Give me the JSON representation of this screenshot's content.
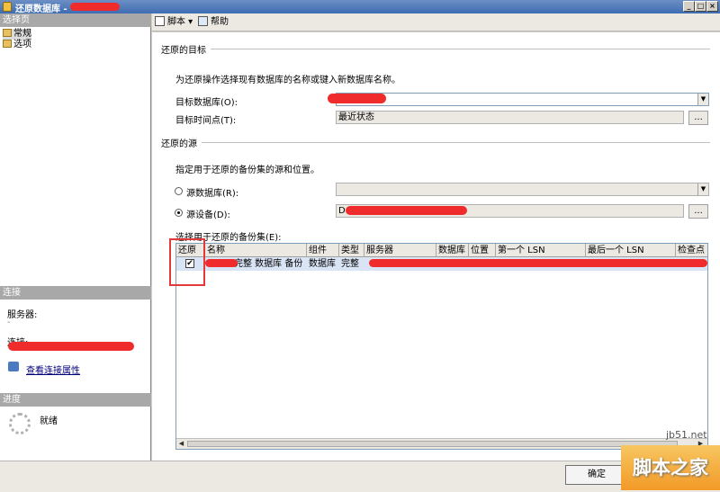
{
  "window": {
    "title": "还原数据库 -"
  },
  "left": {
    "select_page_header": "选择页",
    "pages": [
      {
        "label": "常规",
        "icon": "page-icon",
        "selected": true
      },
      {
        "label": "选项",
        "icon": "page-icon",
        "selected": false
      }
    ],
    "connection_header": "连接",
    "server_label": "服务器:",
    "server_value": "-",
    "connection_label": "连接:",
    "view_link": "查看连接属性",
    "progress_header": "进度",
    "status": "就绪"
  },
  "toolbar": {
    "script": "脚本 ▾",
    "help": "帮助"
  },
  "destination": {
    "heading": "还原的目标",
    "description": "为还原操作选择现有数据库的名称或键入新数据库名称。",
    "target_db_label": "目标数据库(O):",
    "target_time_label": "目标时间点(T):",
    "target_time_value": "最近状态",
    "ellipsis": "..."
  },
  "source": {
    "heading": "还原的源",
    "description": "指定用于还原的备份集的源和位置。",
    "from_db_label": "源数据库(R):",
    "from_device_label": "源设备(D):",
    "from_device_value": "D:\\",
    "ellipsis": "..."
  },
  "backup_sets": {
    "label": "选择用于还原的备份集(E):",
    "columns": [
      "还原",
      "名称",
      "组件",
      "类型",
      "服务器",
      "数据库",
      "位置",
      "第一个 LSN",
      "最后一个 LSN",
      "检查点"
    ],
    "rows": [
      {
        "restore": true,
        "name": "完整 数据库 备份",
        "component": "数据库",
        "type": "完整"
      }
    ]
  },
  "buttons": {
    "ok": "确定"
  },
  "watermark": {
    "site": "jb51.net",
    "brand": "脚本之家"
  },
  "colors": {
    "title_bar": "#3e6db2",
    "selected_row": "#d9e4f5",
    "redaction": "#ef2b2b",
    "highlight_box": "#e23a3a"
  }
}
